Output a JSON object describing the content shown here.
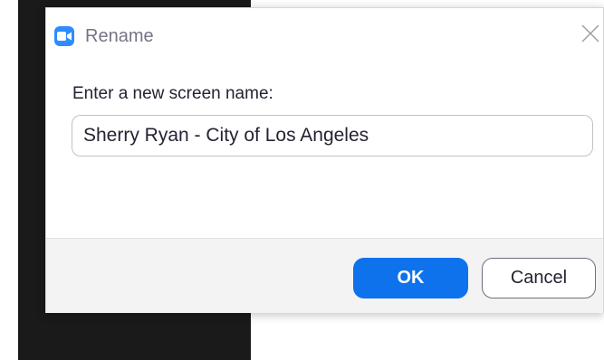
{
  "dialog": {
    "title": "Rename",
    "app_icon": "zoom-video-camera-icon",
    "close_icon": "close-icon",
    "prompt": "Enter a new screen name:",
    "name_value": "Sherry Ryan - City of Los Angeles",
    "ok_label": "OK",
    "cancel_label": "Cancel"
  },
  "colors": {
    "accent": "#0e72ed",
    "app_icon_bg": "#2d8cff",
    "title_text": "#747487",
    "background_dark": "#1a1a1a",
    "footer_bg": "#f3f3f3"
  }
}
